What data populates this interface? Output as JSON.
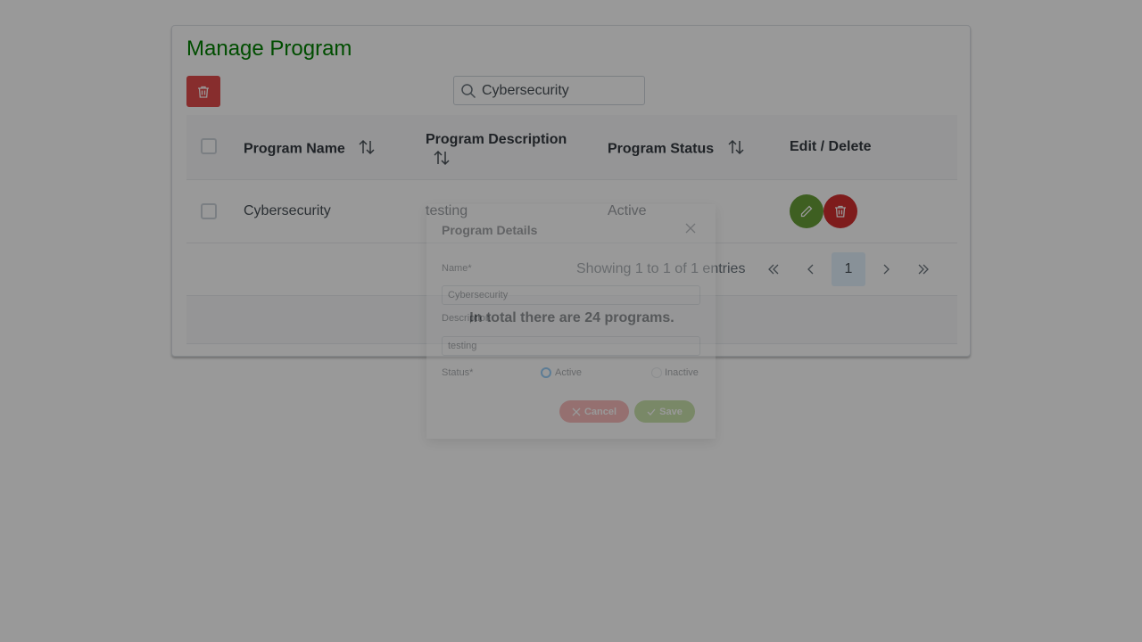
{
  "page": {
    "title": "Manage Program",
    "accent_color": "#008000"
  },
  "toolbar": {
    "bulk_delete_icon": "trash-icon",
    "search": {
      "value": "Cybersecurity",
      "icon": "search-icon"
    }
  },
  "table": {
    "columns": [
      {
        "label": "Program Name",
        "sortable": true
      },
      {
        "label": "Program Description",
        "sortable": true
      },
      {
        "label": "Program Status",
        "sortable": true
      },
      {
        "label": "Edit / Delete",
        "sortable": false
      }
    ],
    "rows": [
      {
        "name": "Cybersecurity",
        "description": "testing",
        "status": "Active"
      }
    ],
    "edit_button_color": "#689f38",
    "delete_button_color": "#d32f2f"
  },
  "paginator": {
    "info": "Showing 1 to 1 of 1 entries",
    "current_page": "1"
  },
  "footer": {
    "summary": "In total there are 24 programs."
  },
  "dialog": {
    "title": "Program Details",
    "name_label": "Name*",
    "name_value": "Cybersecurity",
    "description_label": "Description",
    "description_value": "testing",
    "status_label": "Status*",
    "status_options": [
      "Active",
      "Inactive"
    ],
    "cancel_label": "Cancel",
    "save_label": "Save"
  }
}
